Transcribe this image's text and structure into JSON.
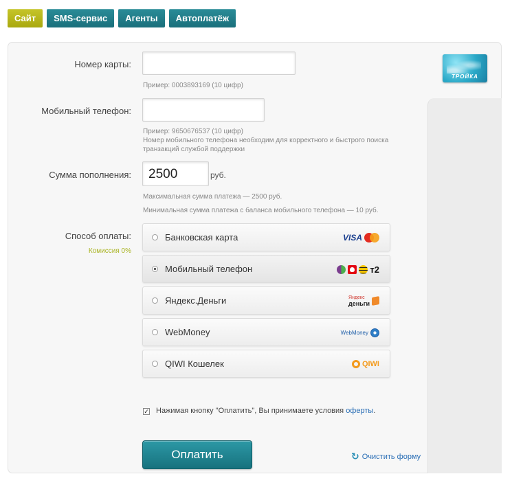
{
  "tabs": [
    {
      "label": "Сайт",
      "active": true
    },
    {
      "label": "SMS-сервис",
      "active": false
    },
    {
      "label": "Агенты",
      "active": false
    },
    {
      "label": "Автоплатёж",
      "active": false
    }
  ],
  "logo": {
    "text": "ТРОЙКА",
    "icon": "troika-card-icon"
  },
  "card": {
    "label": "Номер карты:",
    "value": "",
    "hint": "Пример: 0003893169 (10 цифр)"
  },
  "phone": {
    "label": "Мобильный телефон:",
    "value": "",
    "hint1": "Пример: 9650676537 (10 цифр)",
    "hint2": "Номер мобильного телефона необходим для корректного и быстрого поиска",
    "hint3": "транзакций службой поддержки"
  },
  "amount": {
    "label": "Сумма пополнения:",
    "value": "2500",
    "currency": "руб.",
    "hint_max": "Максимальная сумма платежа — 2500 руб.",
    "hint_min": "Минимальная сумма платежа с баланса мобильного телефона — 10 руб."
  },
  "payment": {
    "label": "Способ оплаты:",
    "commission": "Комиссия 0%",
    "options": [
      {
        "label": "Банковская карта",
        "selected": false,
        "logo": "visa-mastercard"
      },
      {
        "label": "Мобильный телефон",
        "selected": true,
        "logo": "mobile-operators",
        "logo_text": "т2"
      },
      {
        "label": "Яндекс.Деньги",
        "selected": false,
        "logo": "yandex-money",
        "logo_text1": "Яндекс",
        "logo_text2": "деньги"
      },
      {
        "label": "WebMoney",
        "selected": false,
        "logo": "webmoney",
        "logo_text": "WebMoney"
      },
      {
        "label": "QIWI Кошелек",
        "selected": false,
        "logo": "qiwi",
        "logo_text": "QIWI"
      }
    ],
    "visa_text": "VISA"
  },
  "agreement": {
    "checked": true,
    "text": "Нажимая кнопку \"Оплатить\", Вы принимаете условия ",
    "link": "оферты",
    "suffix": "."
  },
  "buttons": {
    "pay": "Оплатить",
    "reset": "Очистить форму"
  },
  "colors": {
    "accent": "#1a7f8b",
    "active_tab": "#b8b71c",
    "link": "#2b6fb6",
    "commission": "#a9b320"
  }
}
